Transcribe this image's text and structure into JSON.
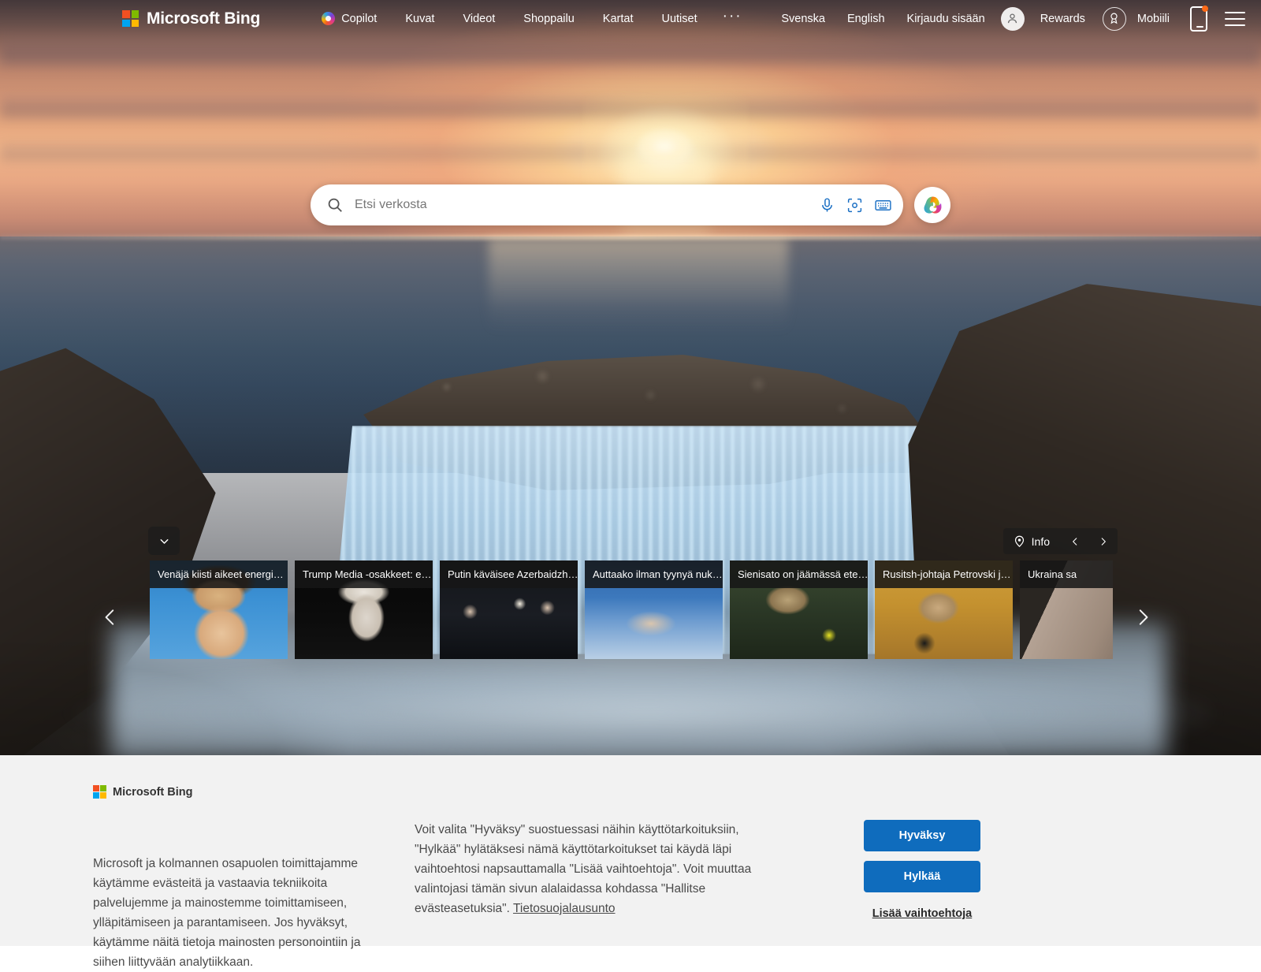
{
  "header": {
    "brand": "Microsoft Bing",
    "nav": [
      {
        "label": "Copilot",
        "icon": "copilot-icon"
      },
      {
        "label": "Kuvat"
      },
      {
        "label": "Videot"
      },
      {
        "label": "Shoppailu"
      },
      {
        "label": "Kartat"
      },
      {
        "label": "Uutiset"
      }
    ],
    "overflow": "···",
    "right": {
      "lang_sv": "Svenska",
      "lang_en": "English",
      "signin": "Kirjaudu sisään",
      "rewards": "Rewards",
      "mobile": "Mobiili"
    }
  },
  "search": {
    "placeholder": "Etsi verkosta",
    "value": "",
    "icons": [
      "search-icon",
      "microphone-icon",
      "visual-search-icon",
      "keyboard-icon"
    ],
    "copilot_button": "copilot-icon"
  },
  "carousel": {
    "collapse": "chevron-down-icon",
    "info_label": "Info",
    "prev": "‹",
    "next": "›",
    "cards": [
      {
        "title": "Venäjä kiisti aikeet energi…",
        "thumb": "t1"
      },
      {
        "title": "Trump Media -osakkeet: e…",
        "thumb": "t2"
      },
      {
        "title": "Putin käväisee Azerbaidzh…",
        "thumb": "t3"
      },
      {
        "title": "Auttaako ilman tyynyä nuk…",
        "thumb": "t4"
      },
      {
        "title": "Sienisato on jäämässä ete…",
        "thumb": "t5"
      },
      {
        "title": "Rusitsh-johtaja Petrovski j…",
        "thumb": "t6"
      },
      {
        "title": "Ukraina sa",
        "thumb": "t7"
      }
    ]
  },
  "cookie": {
    "brand": "Microsoft Bing",
    "paragraph1": "Microsoft ja kolmannen osapuolen toimittajamme käytämme evästeitä ja vastaavia tekniikoita palvelujemme ja mainostemme toimittamiseen, ylläpitämiseen ja parantamiseen. Jos hyväksyt, käytämme näitä tietoja mainosten personointiin ja siihen liittyvään analytiikkaan.",
    "paragraph2": "Voit valita \"Hyväksy\" suostuessasi näihin käyttötarkoituksiin, \"Hylkää\" hylätäksesi nämä käyttötarkoitukset tai käydä läpi vaihtoehtosi napsauttamalla \"Lisää vaihtoehtoja\". Voit muuttaa valintojasi tämän sivun alalaidassa kohdassa \"Hallitse evästeasetuksia\". ",
    "privacy_link": "Tietosuojalausunto",
    "accept": "Hyväksy",
    "reject": "Hylkää",
    "more_options": "Lisää vaihtoehtoja"
  },
  "colors": {
    "accent_blue": "#0f6cbd",
    "banner_bg": "#f2f2f2",
    "ms_red": "#f25022",
    "ms_green": "#7fba00",
    "ms_blue": "#00a4ef",
    "ms_yellow": "#ffb900"
  }
}
